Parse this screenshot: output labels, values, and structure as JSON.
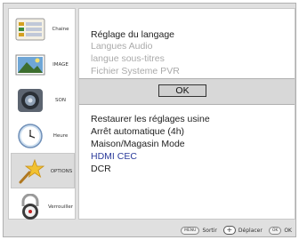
{
  "sidebar": {
    "items": [
      {
        "label": "Chaine",
        "icon": "channel-list-icon"
      },
      {
        "label": "IMAGE",
        "icon": "picture-icon"
      },
      {
        "label": "SON",
        "icon": "speaker-icon"
      },
      {
        "label": "Heure",
        "icon": "clock-icon"
      },
      {
        "label": "OPTIONS",
        "icon": "star-icon",
        "active": true
      },
      {
        "label": "Verrouiller",
        "icon": "padlock-icon"
      }
    ]
  },
  "main": {
    "top_items": [
      {
        "label": "Réglage du langage",
        "enabled": true
      },
      {
        "label": "Langues Audio",
        "enabled": false
      },
      {
        "label": "langue sous-titres",
        "enabled": false
      },
      {
        "label": "Fichier Systeme PVR",
        "enabled": false
      }
    ],
    "ok_label": "OK",
    "bottom_items": [
      {
        "label": "Restaurer les réglages usine"
      },
      {
        "label": "Arrêt automatique (4h)"
      },
      {
        "label": "Maison/Magasin Mode"
      },
      {
        "label": "HDMI CEC",
        "highlighted": true
      },
      {
        "label": "DCR"
      }
    ]
  },
  "footer": {
    "menu_key": "MENU",
    "menu_label": "Sortir",
    "move_label": "Déplacer",
    "ok_key": "OK",
    "ok_label": "OK"
  },
  "colors": {
    "highlight_text": "#2a3a9a",
    "disabled_text": "#aaaaaa",
    "background": "#e0e0e0"
  }
}
